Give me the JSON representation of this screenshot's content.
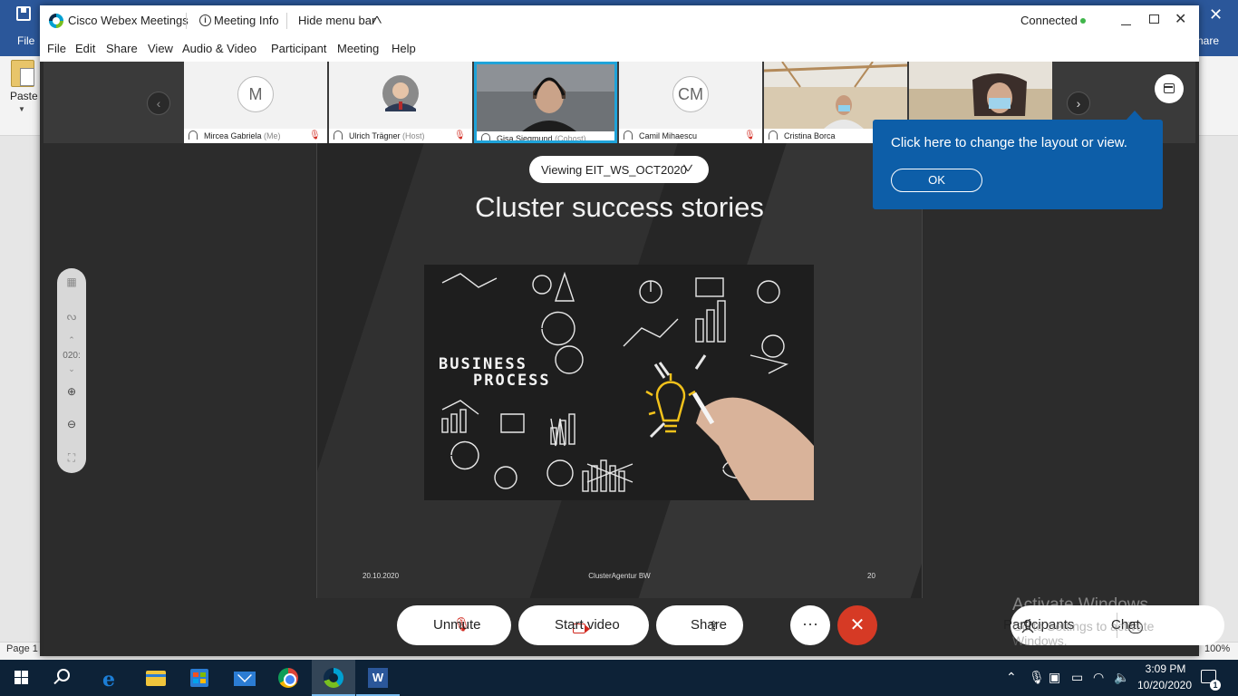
{
  "word": {
    "file_tab": "File",
    "share_tab": "hare",
    "paste_label": "Paste",
    "page_status": "Page 1",
    "zoom_status": "100%"
  },
  "webex": {
    "app_title": "Cisco Webex Meetings",
    "meeting_info": "Meeting Info",
    "hide_menu_bar": "Hide menu bar",
    "status": "Connected",
    "status_color": "#3fb54a",
    "menu": [
      "File",
      "Edit",
      "Share",
      "View",
      "Audio & Video",
      "Participant",
      "Meeting",
      "Help"
    ],
    "participants": [
      {
        "name": "Mircea Gabriela",
        "role": "(Me)",
        "avatar_initials": "M",
        "muted": true
      },
      {
        "name": "Ulrich Trägner",
        "role": "(Host)",
        "muted": true
      },
      {
        "name": "Gisa Siegmund",
        "role": "(Cohost)",
        "active_speaker": true
      },
      {
        "name": "Camil Mihaescu",
        "role": "",
        "avatar_initials": "CM",
        "muted": true
      },
      {
        "name": "Cristina Borca",
        "role": ""
      }
    ],
    "tooltip": {
      "text": "Click here to change the layout or view.",
      "ok": "OK",
      "bg_color": "#0d5ea8"
    },
    "viewing": "Viewing EIT_WS_OCT2020",
    "annotation": {
      "zoom_value": "020:"
    },
    "slide": {
      "title": "Cluster success stories",
      "date": "20.10.2020",
      "footer": "ClusterAgentur BW",
      "page_number": "20",
      "image_text_1": "BUSINESS",
      "image_text_2": "PROCESS"
    },
    "controls": {
      "unmute": "Unmute",
      "start_video": "Start video",
      "share": "Share",
      "more": "···",
      "participants": "Participants",
      "chat": "Chat",
      "leave_color": "#d63a25"
    },
    "watermark": {
      "line1": "Activate Windows",
      "line2": "Go to Settings to activate Windows."
    }
  },
  "taskbar": {
    "time": "3:09 PM",
    "date": "10/20/2020",
    "notification_count": "1",
    "word_letter": "W",
    "edge_letter": "e"
  }
}
